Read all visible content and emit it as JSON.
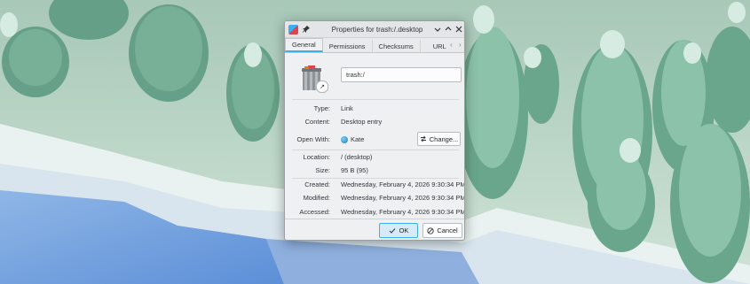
{
  "window": {
    "title": "Properties for trash:/.desktop"
  },
  "tabs": [
    {
      "label": "General"
    },
    {
      "label": "Permissions"
    },
    {
      "label": "Checksums"
    },
    {
      "label": "URL"
    }
  ],
  "file": {
    "name": "trash:/"
  },
  "properties": {
    "type_label": "Type:",
    "type_value": "Link",
    "content_label": "Content:",
    "content_value": "Desktop entry",
    "openwith_label": "Open With:",
    "openwith_value": "Kate",
    "change_button": "Change...",
    "location_label": "Location:",
    "location_value": "/ (desktop)",
    "size_label": "Size:",
    "size_value": "95 B (95)",
    "created_label": "Created:",
    "created_value": "Wednesday, February 4, 2026 9:30:34 PM",
    "modified_label": "Modified:",
    "modified_value": "Wednesday, February 4, 2026 9:30:34 PM",
    "accessed_label": "Accessed:",
    "accessed_value": "Wednesday, February 4, 2026 9:30:34 PM"
  },
  "buttons": {
    "ok": "OK",
    "cancel": "Cancel"
  },
  "colors": {
    "accent": "#3daee9",
    "dialog_bg": "#eff0f1"
  }
}
